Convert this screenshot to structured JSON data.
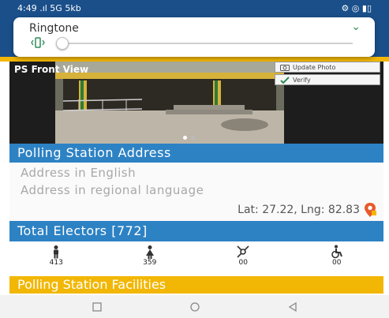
{
  "status_bar": {
    "left_text": "4:49 .ıl 5G 5kb",
    "right_text": "⚙ ◎ ▮▯"
  },
  "volume": {
    "title": "Ringtone",
    "level": 0.0,
    "icon": "vibrate-icon",
    "chevron_icon": "chevron-down-icon"
  },
  "photo": {
    "caption": "PS Front View",
    "update_label": "Update Photo",
    "verify_label": "Verify",
    "page_count": 2,
    "active_page": 0
  },
  "address": {
    "section_title": "Polling Station Address",
    "english": "Address in English",
    "regional": "Address in regional language",
    "latlng": "Lat: 27.22, Lng: 82.83",
    "pin_icon": "location-pin-icon"
  },
  "electors": {
    "section_title": "Total Electors [772]",
    "groups": [
      {
        "icon": "male-icon",
        "count": "413"
      },
      {
        "icon": "female-icon",
        "count": "359"
      },
      {
        "icon": "third-gender-icon",
        "count": "00"
      },
      {
        "icon": "wheelchair-icon",
        "count": "00"
      }
    ]
  },
  "facilities": {
    "section_title": "Polling Station Facilities"
  },
  "nav": {
    "items": [
      "recent-apps-icon",
      "home-icon",
      "back-icon"
    ]
  },
  "colors": {
    "primary": "#1a4f8a",
    "section_blue": "#2d82c4",
    "accent_yellow": "#f2b705",
    "pin_orange": "#e85a2a"
  }
}
